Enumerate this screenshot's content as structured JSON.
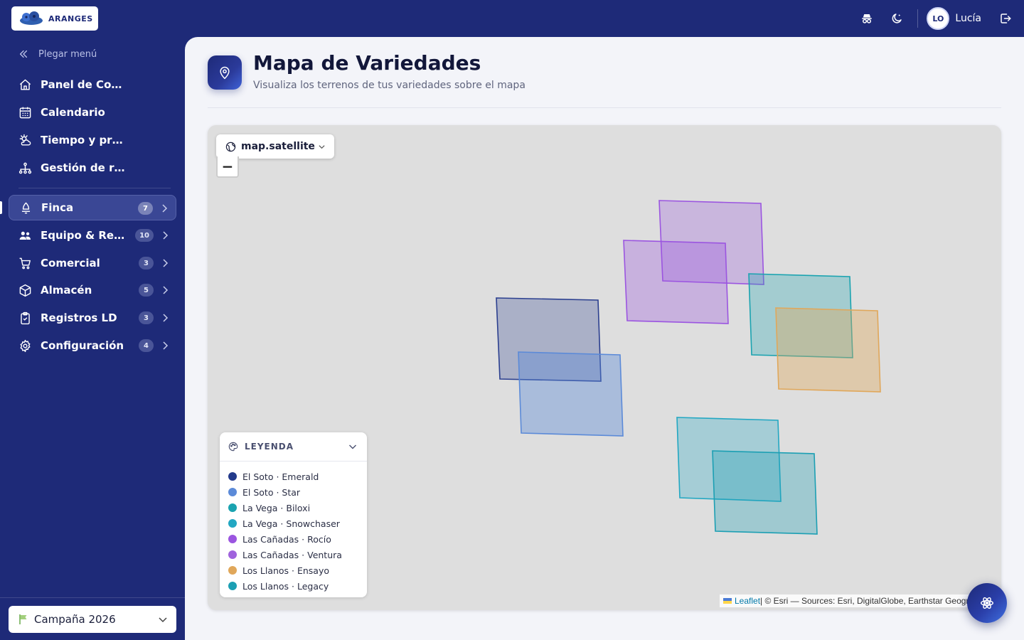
{
  "app": {
    "brand": "ARANGES"
  },
  "topbar": {
    "user_initials": "LO",
    "user_name": "Lucía",
    "icons": [
      "incognito-icon",
      "moon-icon",
      "logout-icon"
    ]
  },
  "sidebar": {
    "collapse_label": "Plegar menú",
    "items": [
      {
        "label": "Panel de Control",
        "icon": "home-icon"
      },
      {
        "label": "Calendario",
        "icon": "calendar-icon"
      },
      {
        "label": "Tiempo y previsión",
        "icon": "weather-icon"
      },
      {
        "label": "Gestión de riego",
        "icon": "irrigation-icon"
      },
      {
        "label": "Finca",
        "icon": "sprout-icon",
        "badge": "7",
        "active": true
      },
      {
        "label": "Equipo & Recursos",
        "icon": "team-icon",
        "badge": "10"
      },
      {
        "label": "Comercial",
        "icon": "cart-icon",
        "badge": "3"
      },
      {
        "label": "Almacén",
        "icon": "box-icon",
        "badge": "5"
      },
      {
        "label": "Registros LD",
        "icon": "clipboard-icon",
        "badge": "3"
      },
      {
        "label": "Configuración",
        "icon": "gear-icon",
        "badge": "4"
      }
    ],
    "campaign_label": "Campaña 2026"
  },
  "page": {
    "title": "Mapa de Variedades",
    "subtitle": "Visualiza los terrenos de tus variedades sobre el mapa"
  },
  "map": {
    "layer_label": "map.satellite",
    "zoom_out_label": "−",
    "legend_title": "LEYENDA",
    "legend": [
      {
        "label": "El Soto · Emerald",
        "color": "#233a8b"
      },
      {
        "label": "El Soto · Star",
        "color": "#5b8ad8"
      },
      {
        "label": "La Vega · Biloxi",
        "color": "#1aa3b0"
      },
      {
        "label": "La Vega · Snowchaser",
        "color": "#22a7c2"
      },
      {
        "label": "Las Cañadas · Rocío",
        "color": "#9b55e0"
      },
      {
        "label": "Las Cañadas · Ventura",
        "color": "#a063dd"
      },
      {
        "label": "Los Llanos · Ensayo",
        "color": "#e0a75a"
      },
      {
        "label": "Los Llanos · Legacy",
        "color": "#1c9fb3"
      }
    ],
    "attribution_link": "Leaflet",
    "attribution_text": " | © Esri — Sources: Esri, DigitalGlobe, Earthstar Geographics"
  }
}
